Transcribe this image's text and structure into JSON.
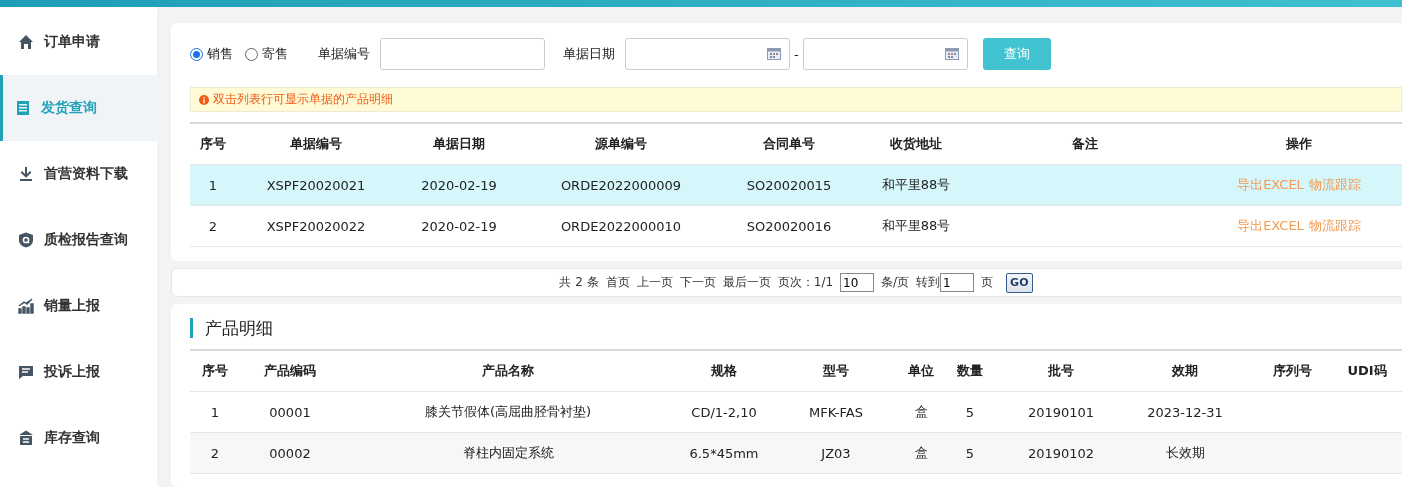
{
  "sidebar": {
    "items": [
      {
        "label": "订单申请",
        "selected": false
      },
      {
        "label": "发货查询",
        "selected": true
      },
      {
        "label": "首营资料下载",
        "selected": false
      },
      {
        "label": "质检报告查询",
        "selected": false
      },
      {
        "label": "销量上报",
        "selected": false
      },
      {
        "label": "投诉上报",
        "selected": false
      },
      {
        "label": "库存查询",
        "selected": false
      }
    ]
  },
  "filter": {
    "radios": [
      {
        "label": "销售",
        "selected": true
      },
      {
        "label": "寄售",
        "selected": false
      }
    ],
    "doc_no_label": "单据编号",
    "date_label": "单据日期",
    "date_separator": "-",
    "query_button": "查询"
  },
  "notice": "双击列表行可显示单据的产品明细",
  "orders": {
    "columns": [
      "序号",
      "单据编号",
      "单据日期",
      "源单编号",
      "合同单号",
      "收货地址",
      "备注",
      "操作"
    ],
    "rows": [
      {
        "selected": true,
        "cells": [
          "1",
          "XSPF20020021",
          "2020-02-19",
          "ORDE2022000009",
          "SO20020015",
          "和平里88号",
          ""
        ],
        "actions": [
          "导出EXCEL",
          "物流跟踪"
        ]
      },
      {
        "selected": false,
        "cells": [
          "2",
          "XSPF20020022",
          "2020-02-19",
          "ORDE2022000010",
          "SO20020016",
          "和平里88号",
          ""
        ],
        "actions": [
          "导出EXCEL",
          "物流跟踪"
        ]
      }
    ]
  },
  "pagination": {
    "total": "共 2 条",
    "links": [
      "首页",
      "上一页",
      "下一页",
      "最后一页"
    ],
    "page_info": "页次：1/1",
    "page_size": "10",
    "per_page": "条/页",
    "goto": "转到",
    "goto_value": "1",
    "page_unit": "页",
    "go": "GO"
  },
  "products": {
    "title": "产品明细",
    "columns": [
      "序号",
      "产品编码",
      "产品名称",
      "规格",
      "型号",
      "单位",
      "数量",
      "批号",
      "效期",
      "序列号",
      "UDI码"
    ],
    "rows": [
      {
        "cells": [
          "1",
          "00001",
          "膝关节假体(高屈曲胫骨衬垫)",
          "CD/1-2,10",
          "MFK-FAS",
          "盒",
          "5",
          "20190101",
          "2023-12-31",
          "",
          ""
        ]
      },
      {
        "cells": [
          "2",
          "00002",
          "脊柱内固定系统",
          "6.5*45mm",
          "JZ03",
          "盒",
          "5",
          "20190102",
          "长效期",
          "",
          ""
        ]
      }
    ]
  }
}
